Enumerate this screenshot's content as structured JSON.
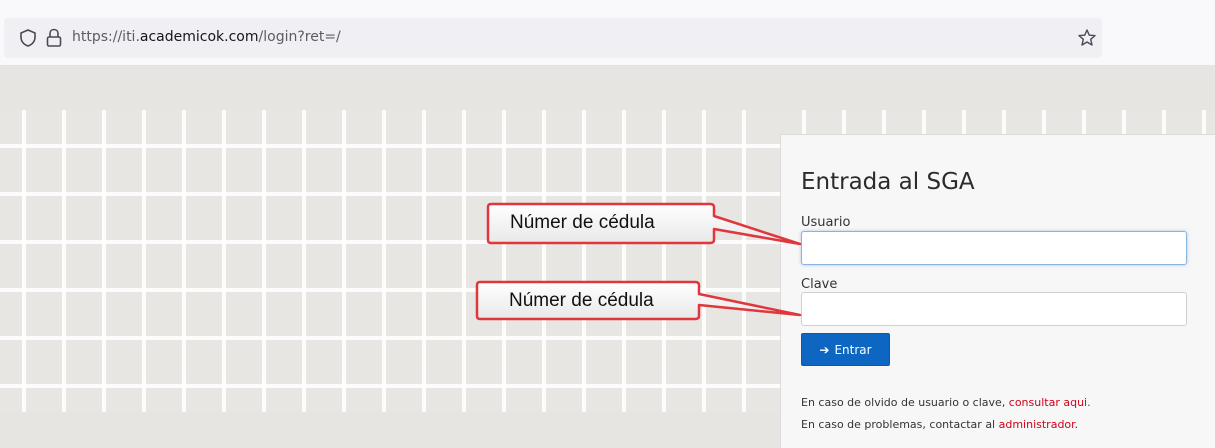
{
  "browser": {
    "url_prefix": "https://iti.",
    "url_domain": "academicok.com",
    "url_path": "/login?ret=/",
    "icons": [
      "shield-icon",
      "lock-icon",
      "star-icon"
    ]
  },
  "login": {
    "title": "Entrada al SGA",
    "username_label": "Usuario",
    "username_value": "",
    "password_label": "Clave",
    "password_value": "",
    "submit_label": "Entrar",
    "submit_icon": "arrow-right-icon",
    "help1_text": "En caso de olvido de usuario o clave, ",
    "help1_link": "consultar aqui.",
    "help2_text": "En caso de problemas, contactar al ",
    "help2_link": "administrador",
    "help2_suffix": ".",
    "primary_color": "#0d66c2",
    "link_color": "#d0021b"
  },
  "callouts": {
    "first": "Númer de cédula",
    "second": "Númer de cédula",
    "border_color": "#e0363c"
  }
}
